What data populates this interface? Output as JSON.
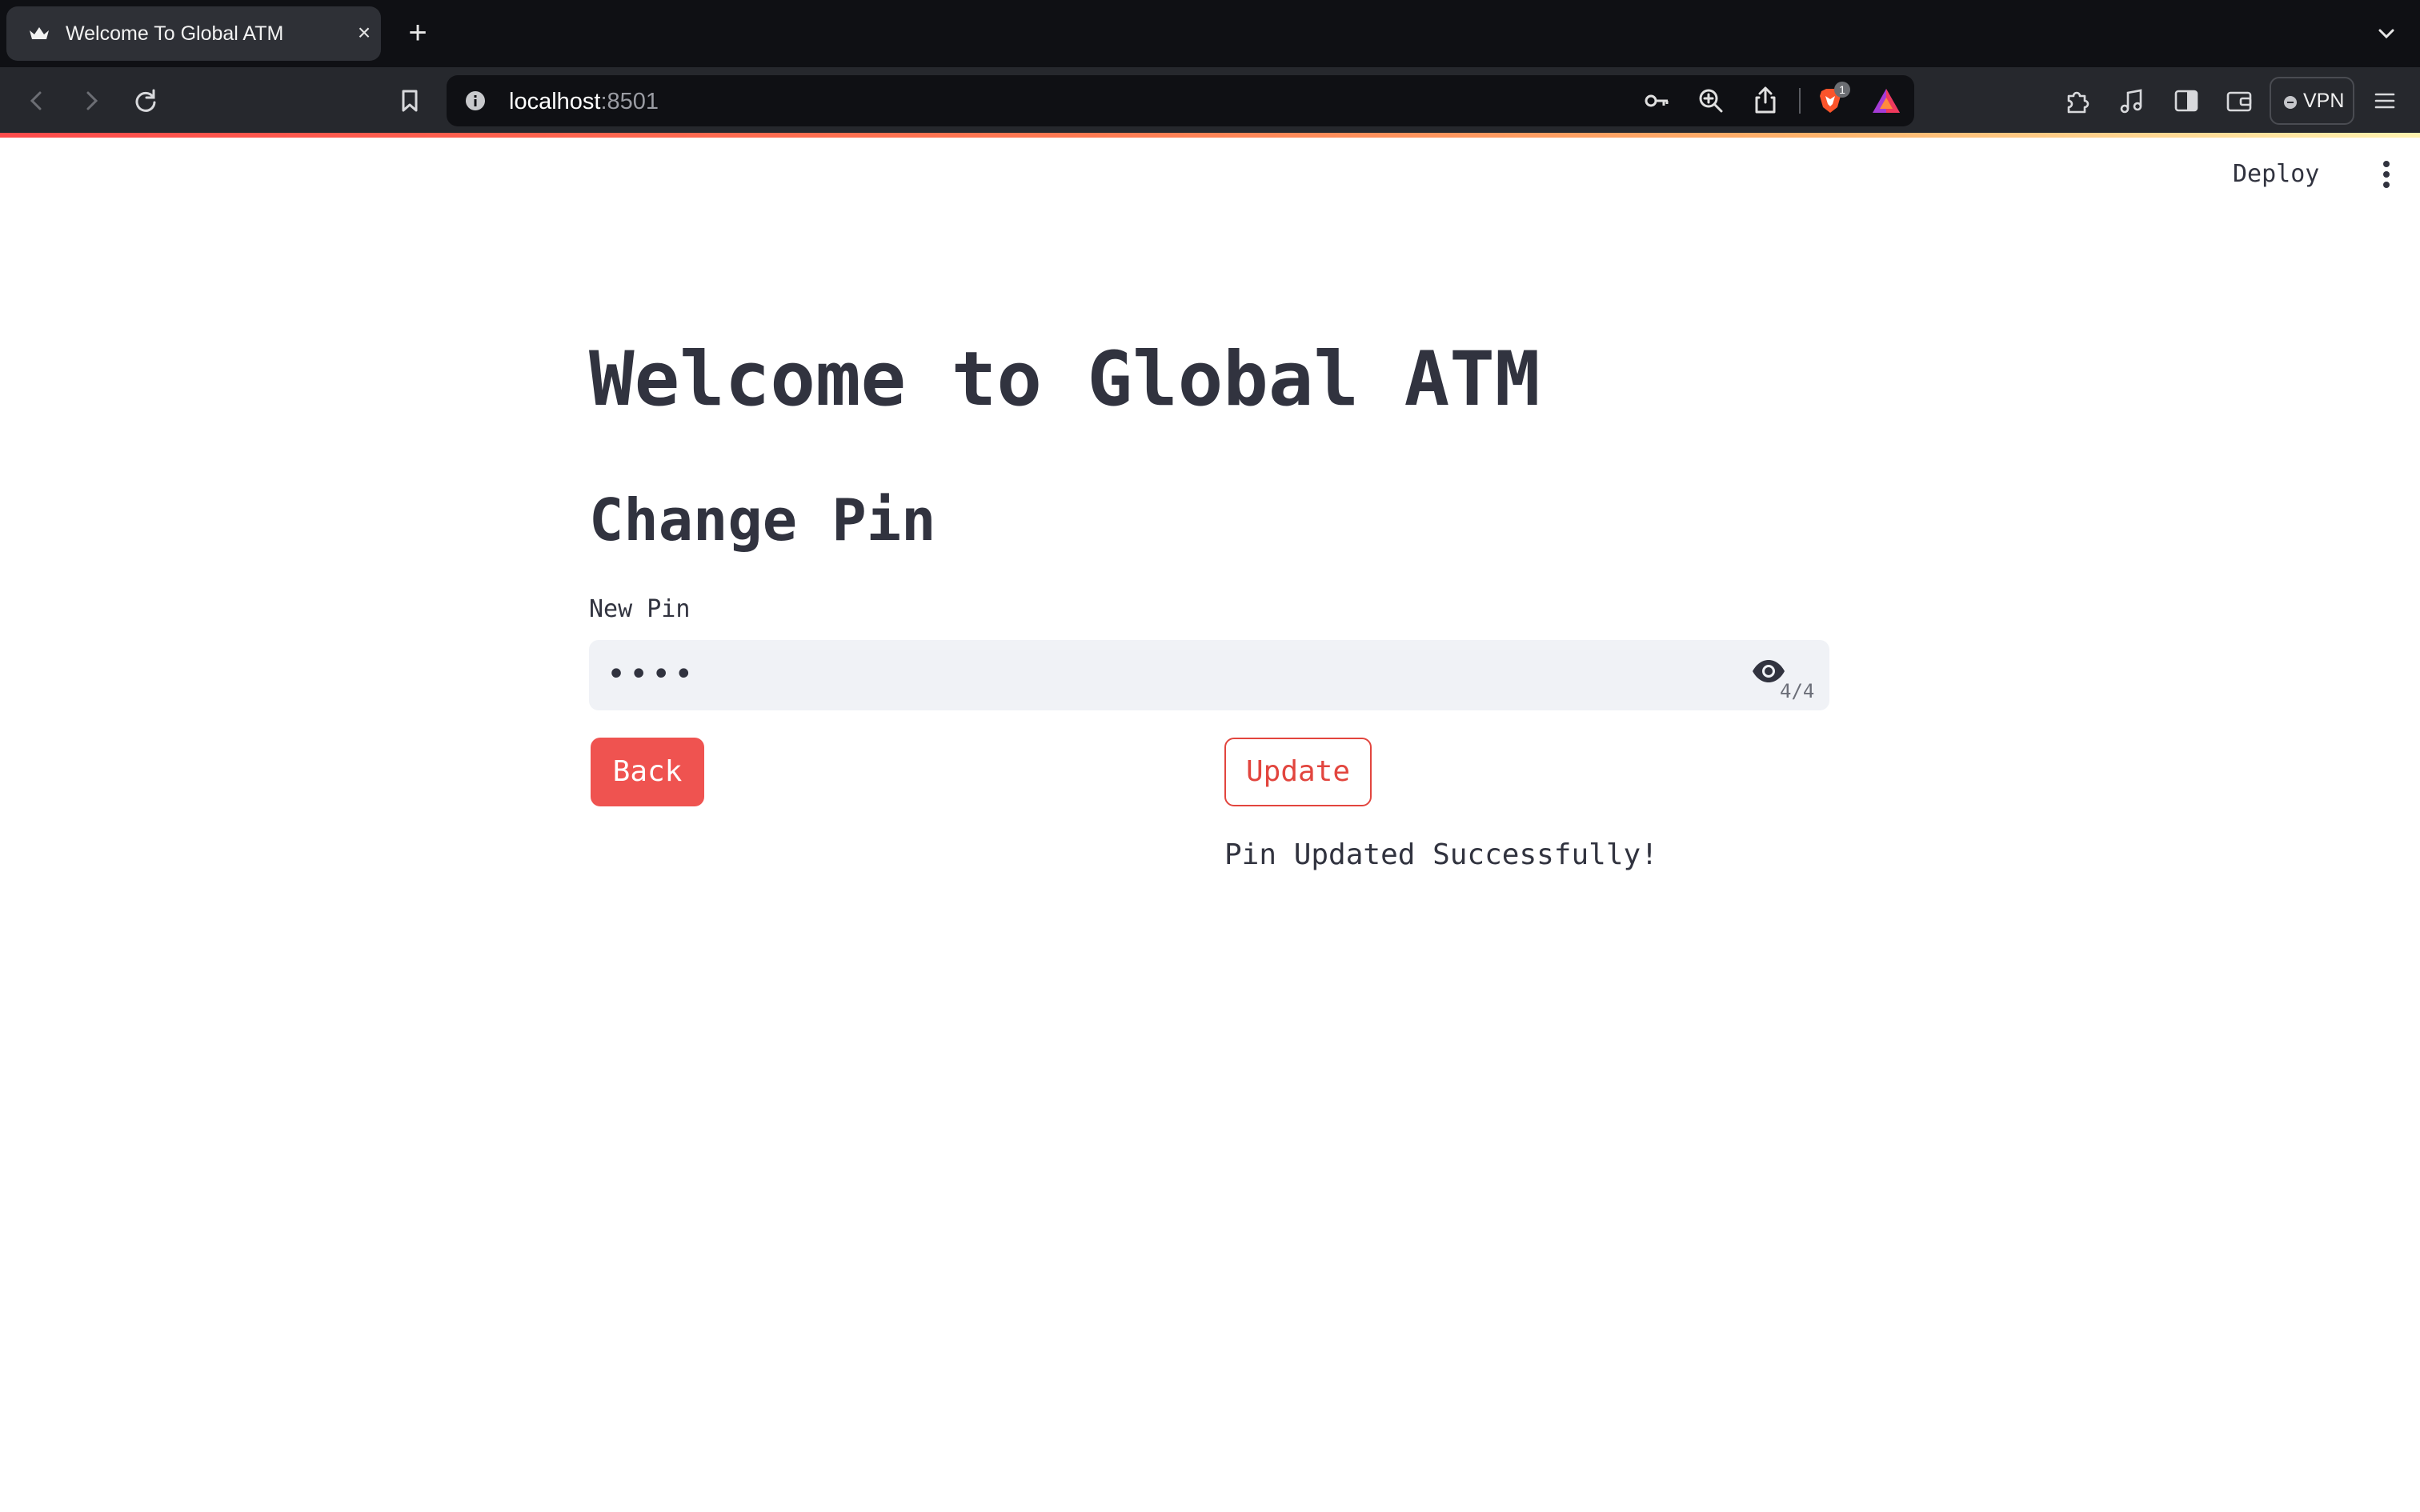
{
  "browser": {
    "tab_title": "Welcome To Global ATM",
    "tab_close": "×",
    "new_tab": "+",
    "url_host": "localhost",
    "url_port": ":8501",
    "vpn_label": "VPN",
    "brave_badge": "1",
    "icons": [
      "back-icon",
      "forward-icon",
      "reload-icon",
      "bookmark-icon",
      "site-info-icon",
      "key-icon",
      "zoom-icon",
      "share-icon",
      "brave-shields-icon",
      "brave-rewards-icon",
      "extensions-icon",
      "media-icon",
      "sidebar-icon",
      "wallet-icon",
      "menu-icon"
    ]
  },
  "app": {
    "deploy_label": "Deploy",
    "title": "Welcome to Global ATM",
    "subtitle": "Change Pin",
    "pin_field": {
      "label": "New Pin",
      "masked_value": "••••",
      "char_count": "4/4"
    },
    "back_button": "Back",
    "update_button": "Update",
    "status_message": "Pin Updated Successfully!"
  },
  "colors": {
    "primary": "#ff4b4b",
    "text": "#31333f",
    "input_bg": "#f0f2f6",
    "chrome_dark": "#0f1014",
    "chrome_toolbar": "#26282d"
  }
}
